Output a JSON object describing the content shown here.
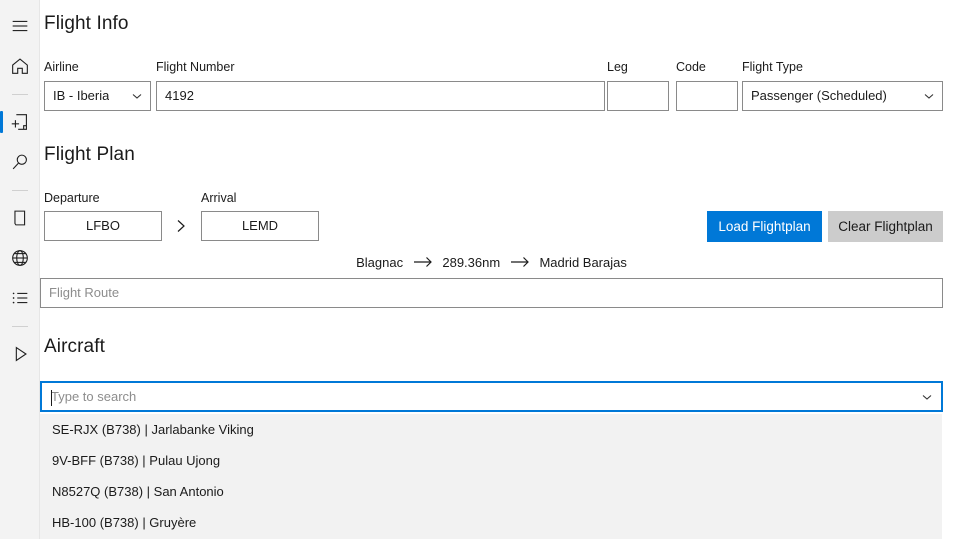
{
  "sidebar": {
    "items": [
      {
        "id": "menu",
        "icon": "hamburger-menu-icon",
        "selected": false
      },
      {
        "id": "home",
        "icon": "home-icon",
        "selected": false
      },
      {
        "id": "separator-1",
        "icon": "separator",
        "selected": false
      },
      {
        "id": "new-flight",
        "icon": "new-document-icon",
        "selected": true
      },
      {
        "id": "search",
        "icon": "search-icon",
        "selected": false
      },
      {
        "id": "separator-2",
        "icon": "separator",
        "selected": false
      },
      {
        "id": "documents",
        "icon": "document-icon",
        "selected": false
      },
      {
        "id": "network",
        "icon": "globe-icon",
        "selected": false
      },
      {
        "id": "logs",
        "icon": "list-icon",
        "selected": false
      },
      {
        "id": "separator-3",
        "icon": "separator",
        "selected": false
      },
      {
        "id": "start",
        "icon": "play-icon",
        "selected": false
      }
    ]
  },
  "flight_info": {
    "title": "Flight Info",
    "airline_label": "Airline",
    "airline_value": "IB - Iberia",
    "flight_number_label": "Flight Number",
    "flight_number_value": "4192",
    "leg_label": "Leg",
    "leg_value": "",
    "code_label": "Code",
    "code_value": "",
    "flight_type_label": "Flight Type",
    "flight_type_value": "Passenger (Scheduled)"
  },
  "flight_plan": {
    "title": "Flight Plan",
    "departure_label": "Departure",
    "departure_value": "LFBO",
    "arrival_label": "Arrival",
    "arrival_value": "LEMD",
    "load_button": "Load Flightplan",
    "clear_button": "Clear Flightplan",
    "route_from": "Blagnac",
    "route_distance": "289.36nm",
    "route_to": "Madrid Barajas",
    "flight_route_placeholder": "Flight Route",
    "flight_route_value": ""
  },
  "aircraft": {
    "title": "Aircraft",
    "search_placeholder": "Type to search",
    "search_value": "",
    "results": [
      "SE-RJX (B738) | Jarlabanke Viking",
      "9V-BFF (B738) | Pulau Ujong",
      "N8527Q (B738) | San Antonio",
      "HB-100 (B738) | Gruyère"
    ]
  },
  "colors": {
    "accent": "#0078d7",
    "sidebar_bg": "#f3f3f3",
    "dropdown_bg": "#f2f2f2",
    "secondary_button": "#cccccc"
  }
}
